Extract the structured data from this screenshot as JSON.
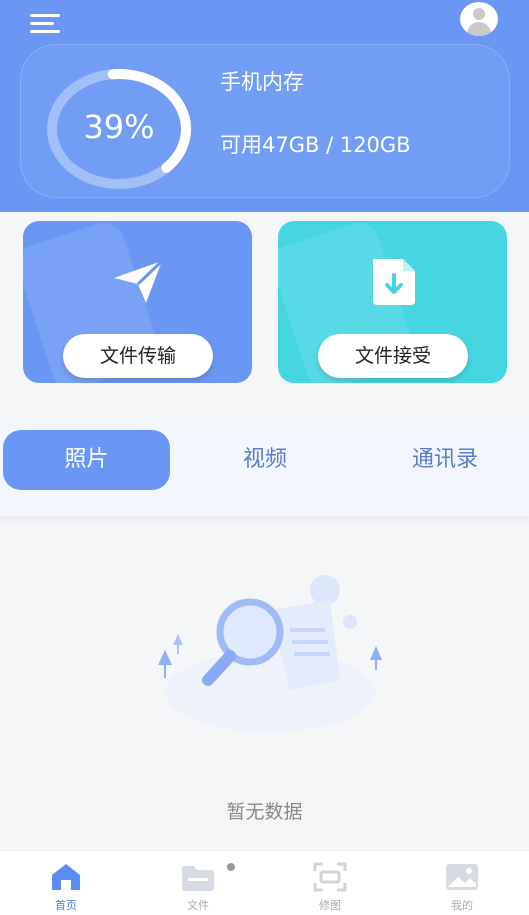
{
  "storage": {
    "percent_text": "39%",
    "used_fraction": 0.39,
    "label": "手机内存",
    "available_text": "可用47GB / 120GB"
  },
  "actions": {
    "send_label": "文件传输",
    "receive_label": "文件接受"
  },
  "tabs": [
    {
      "label": "照片",
      "active": true
    },
    {
      "label": "视频",
      "active": false
    },
    {
      "label": "通讯录",
      "active": false
    }
  ],
  "empty_state": {
    "text": "暂无数据"
  },
  "bottom_nav": [
    {
      "label": "首页",
      "icon": "home-icon",
      "active": true
    },
    {
      "label": "文件",
      "icon": "folder-icon",
      "active": false
    },
    {
      "label": "修图",
      "icon": "crop-icon",
      "active": false
    },
    {
      "label": "我的",
      "icon": "image-icon",
      "active": false
    }
  ],
  "colors": {
    "primary": "#6a97f4",
    "cyan": "#45d6e2",
    "tab_text": "#5b7cc9",
    "nav_active": "#4a7be0"
  }
}
